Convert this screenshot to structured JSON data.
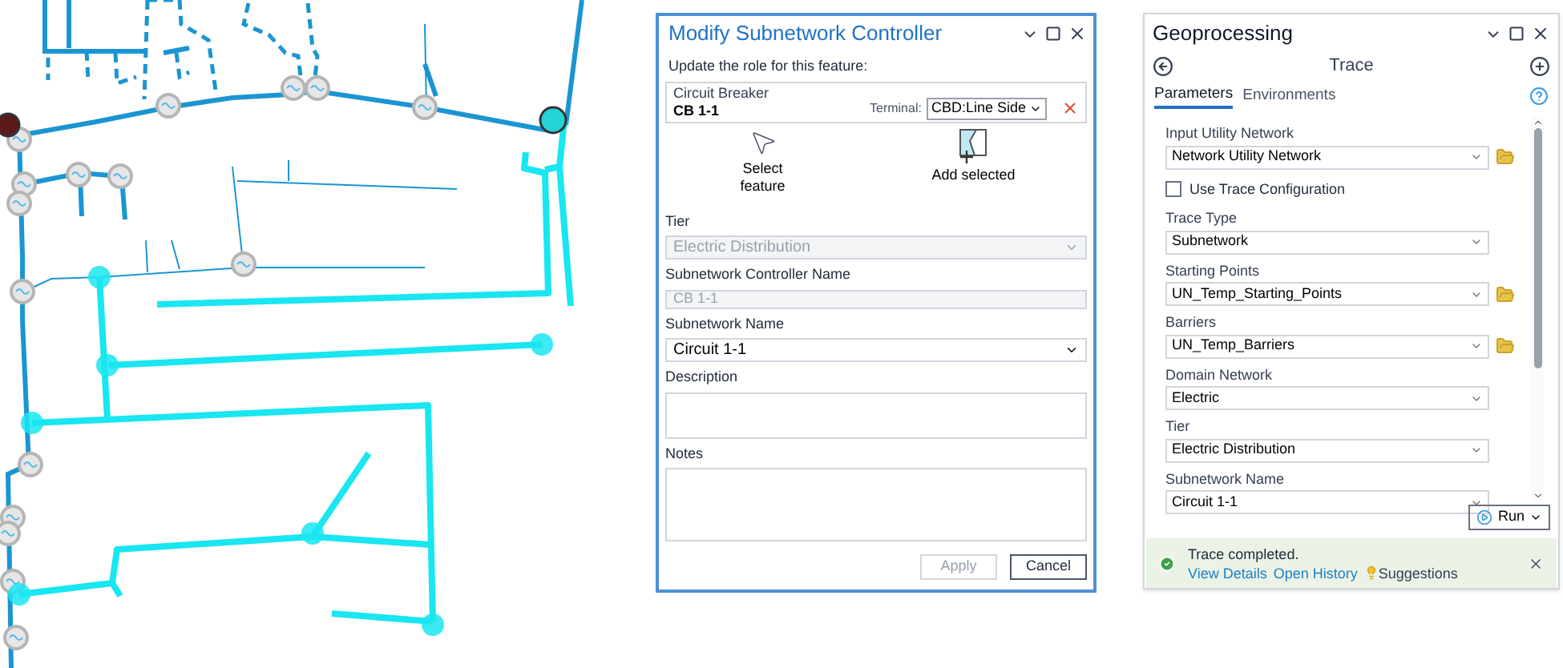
{
  "modify_dialog": {
    "title": "Modify Subnetwork Controller",
    "prompt": "Update the role for this feature:",
    "feature": {
      "type": "Circuit Breaker",
      "name": "CB 1-1",
      "terminal_label": "Terminal:",
      "terminal_value": "CBD:Line Side"
    },
    "tools": [
      {
        "kind": "select",
        "label": "Select feature"
      },
      {
        "kind": "add",
        "label": "Add selected"
      }
    ],
    "fields": [
      {
        "label": "Tier",
        "kind": "dropdown",
        "value": "Electric Distribution",
        "disabled": true
      },
      {
        "label": "Subnetwork Controller Name",
        "kind": "text",
        "value": "CB 1-1",
        "disabled": true
      },
      {
        "label": "Subnetwork Name",
        "kind": "dropdown",
        "value": "Circuit 1-1",
        "disabled": false
      },
      {
        "label": "Description",
        "kind": "textarea",
        "disabled": false
      },
      {
        "label": "Notes",
        "kind": "textarea",
        "disabled": false
      }
    ],
    "buttons": [
      {
        "label": "Apply",
        "disabled": true
      },
      {
        "label": "Cancel",
        "disabled": false
      }
    ]
  },
  "geoprocessing": {
    "title": "Geoprocessing",
    "tool": "Trace",
    "tabs": [
      {
        "label": "Parameters",
        "selected": true
      },
      {
        "label": "Environments",
        "selected": false
      }
    ],
    "parameters": [
      {
        "kind": "dropdown",
        "label": "Input Utility Network",
        "value": "Network Utility Network",
        "browse": true
      },
      {
        "kind": "checkbox",
        "label": "Use Trace Configuration",
        "checked": false
      },
      {
        "kind": "dropdown",
        "label": "Trace Type",
        "value": "Subnetwork",
        "browse": false
      },
      {
        "kind": "dropdown",
        "label": "Starting Points",
        "value": "UN_Temp_Starting_Points",
        "browse": true
      },
      {
        "kind": "dropdown",
        "label": "Barriers",
        "value": "UN_Temp_Barriers",
        "browse": true
      },
      {
        "kind": "dropdown",
        "label": "Domain Network",
        "value": "Electric",
        "browse": false
      },
      {
        "kind": "dropdown",
        "label": "Tier",
        "value": "Electric Distribution",
        "browse": false
      },
      {
        "kind": "dropdown",
        "label": "Subnetwork Name",
        "value": "Circuit 1-1",
        "browse": false
      }
    ],
    "run_button": "Run",
    "status": {
      "message": "Trace completed.",
      "links": [
        "View Details",
        "Open History"
      ],
      "suggestions": "Suggestions"
    }
  }
}
